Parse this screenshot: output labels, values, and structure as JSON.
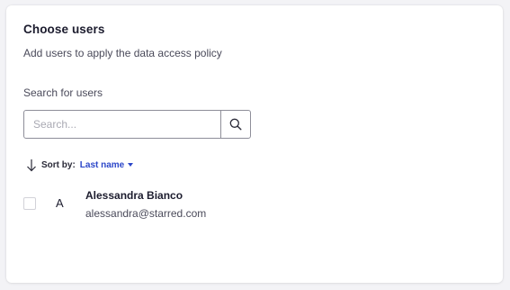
{
  "panel": {
    "title": "Choose users",
    "subtitle": "Add users to apply the data access policy"
  },
  "search": {
    "label": "Search for users",
    "placeholder": "Search...",
    "value": "",
    "button_icon": "search-icon"
  },
  "sort": {
    "icon": "arrow-down-icon",
    "label": "Sort by:",
    "value": "Last name",
    "dropdown_icon": "caret-down-icon"
  },
  "users": [
    {
      "initial": "A",
      "name": "Alessandra Bianco",
      "email": "alessandra@starred.com",
      "checked": false
    }
  ],
  "colors": {
    "accent": "#2c47c9",
    "text_primary": "#1c1c2e",
    "text_secondary": "#4a4a5a",
    "background": "#f3f3f6",
    "card": "#ffffff"
  }
}
